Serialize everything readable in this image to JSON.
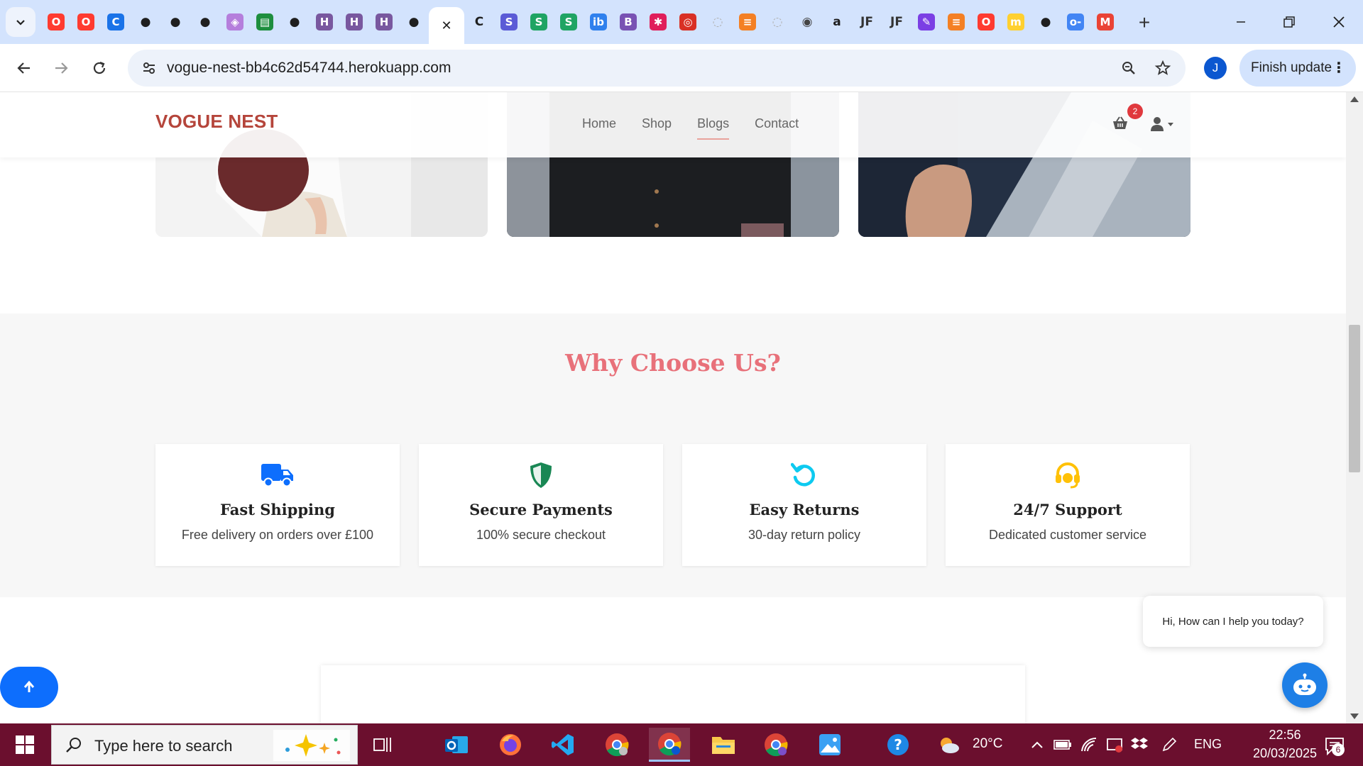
{
  "browser": {
    "url": "vogue-nest-bb4c62d54744.herokuapp.com",
    "finish_update_label": "Finish update",
    "profile_initial": "J",
    "tabs": [
      {
        "icon": "opera-icon",
        "color": "#ff3b30",
        "glyph": "O"
      },
      {
        "icon": "opera-icon",
        "color": "#ff3b30",
        "glyph": "O"
      },
      {
        "icon": "codeanywhere-icon",
        "color": "#1a73e8",
        "glyph": "C"
      },
      {
        "icon": "github-icon",
        "color": "#1f1f1f",
        "glyph": "●"
      },
      {
        "icon": "github-icon",
        "color": "#1f1f1f",
        "glyph": "●"
      },
      {
        "icon": "github-icon",
        "color": "#1f1f1f",
        "glyph": "●"
      },
      {
        "icon": "cube-icon",
        "color": "#b57edc",
        "glyph": "◈"
      },
      {
        "icon": "sheets-icon",
        "color": "#1e8e3e",
        "glyph": "▤"
      },
      {
        "icon": "github-icon",
        "color": "#1f1f1f",
        "glyph": "●"
      },
      {
        "icon": "heroku-icon",
        "color": "#79589f",
        "glyph": "H"
      },
      {
        "icon": "heroku-icon",
        "color": "#79589f",
        "glyph": "H"
      },
      {
        "icon": "heroku-icon",
        "color": "#79589f",
        "glyph": "H"
      },
      {
        "icon": "github-icon",
        "color": "#1f1f1f",
        "glyph": "●"
      },
      {
        "icon": "active-tab-close-icon",
        "color": "#1f1f1f",
        "glyph": "✕",
        "active": true
      },
      {
        "icon": "c-icon",
        "color": "#1f1f1f",
        "glyph": "C"
      },
      {
        "icon": "s-icon",
        "color": "#5b5bd6",
        "glyph": "S"
      },
      {
        "icon": "s-icon",
        "color": "#1fa463",
        "glyph": "S"
      },
      {
        "icon": "s-icon",
        "color": "#1fa463",
        "glyph": "S"
      },
      {
        "icon": "ibb-icon",
        "color": "#2f80ed",
        "glyph": "ib"
      },
      {
        "icon": "bootstrap-icon",
        "color": "#7952b3",
        "glyph": "B"
      },
      {
        "icon": "slack-icon",
        "color": "#e01e5a",
        "glyph": "✱"
      },
      {
        "icon": "target-icon",
        "color": "#d93025",
        "glyph": "◎"
      },
      {
        "icon": "loading-icon",
        "color": "#b0b0b0",
        "glyph": "◌"
      },
      {
        "icon": "stackoverflow-icon",
        "color": "#f48024",
        "glyph": "≡"
      },
      {
        "icon": "loading-icon",
        "color": "#b0b0b0",
        "glyph": "◌"
      },
      {
        "icon": "globe-icon",
        "color": "#444",
        "glyph": "◉"
      },
      {
        "icon": "amazon-icon",
        "color": "#1f1f1f",
        "glyph": "a"
      },
      {
        "icon": "jotform-icon",
        "color": "#333",
        "glyph": "JF"
      },
      {
        "icon": "jotform-icon",
        "color": "#333",
        "glyph": "JF"
      },
      {
        "icon": "pencil-icon",
        "color": "#7b3fe4",
        "glyph": "✎"
      },
      {
        "icon": "stackoverflow-icon",
        "color": "#f48024",
        "glyph": "≡"
      },
      {
        "icon": "opera-icon",
        "color": "#ff3b30",
        "glyph": "O"
      },
      {
        "icon": "miro-icon",
        "color": "#ffd02f",
        "glyph": "m"
      },
      {
        "icon": "github-icon",
        "color": "#1f1f1f",
        "glyph": "●"
      },
      {
        "icon": "google-pass-icon",
        "color": "#4285f4",
        "glyph": "o-"
      },
      {
        "icon": "gmail-icon",
        "color": "#ea4335",
        "glyph": "M"
      }
    ]
  },
  "site": {
    "brand": "VOGUE NEST",
    "nav": [
      "Home",
      "Shop",
      "Blogs",
      "Contact"
    ],
    "cart_count": "2",
    "why_title": "Why Choose Us?",
    "features": [
      {
        "icon": "truck-icon",
        "title": "Fast Shipping",
        "desc": "Free delivery on orders over £100",
        "color": "#0d6efd"
      },
      {
        "icon": "shield-icon",
        "title": "Secure Payments",
        "desc": "100% secure checkout",
        "color": "#198754"
      },
      {
        "icon": "return-icon",
        "title": "Easy Returns",
        "desc": "30-day return policy",
        "color": "#0dcaf0"
      },
      {
        "icon": "headset-icon",
        "title": "24/7 Support",
        "desc": "Dedicated customer service",
        "color": "#ffc107"
      }
    ],
    "chat_prompt": "Hi, How can I help you today?"
  },
  "taskbar": {
    "search_placeholder": "Type here to search",
    "weather": "20°C",
    "language": "ENG",
    "time": "22:56",
    "date": "20/03/2025",
    "notification_count": "6",
    "tray_badge": "6"
  },
  "colors": {
    "brand": "#b5453b",
    "accent_title": "#e8717a",
    "taskbar": "#6b0f2e",
    "primary_button": "#0d6efd"
  }
}
